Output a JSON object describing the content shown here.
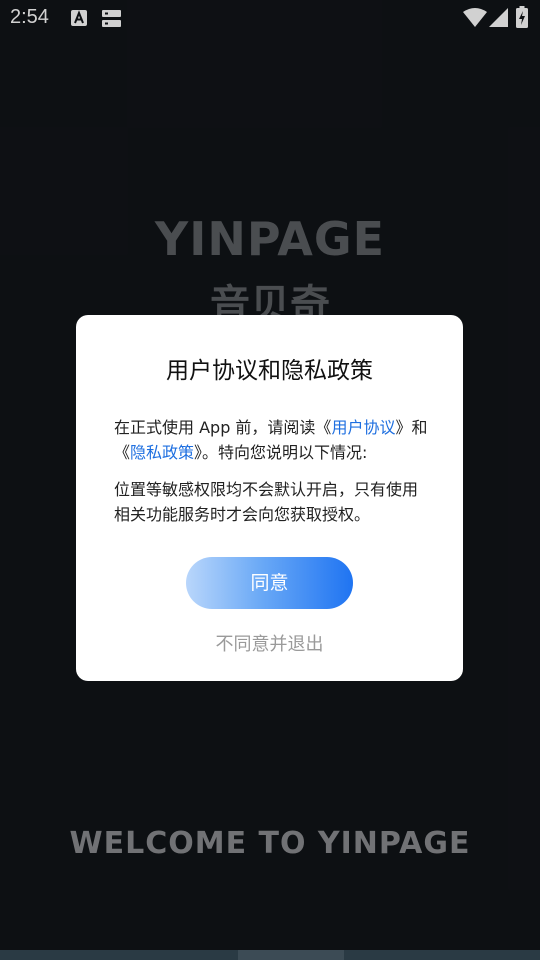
{
  "status_bar": {
    "time": "2:54"
  },
  "splash": {
    "brand_en": "YINPAGE",
    "brand_cn": "音贝奇",
    "welcome": "WELCOME TO YINPAGE"
  },
  "dialog": {
    "title": "用户协议和隐私政策",
    "para1_prefix": "在正式使用 App 前，请阅读《",
    "user_agreement_link": "用户协议",
    "para1_mid": "》和《",
    "privacy_policy_link": "隐私政策",
    "para1_suffix": "》。特向您说明以下情况:",
    "para2": "位置等敏感权限均不会默认开启，只有使用相关功能服务时才会向您获取授权。",
    "agree_label": "同意",
    "decline_label": "不同意并退出"
  },
  "colors": {
    "background": "#111418",
    "link": "#1e6fe0",
    "button_gradient_start": "#b9d6fb",
    "button_gradient_end": "#1f74f2"
  }
}
